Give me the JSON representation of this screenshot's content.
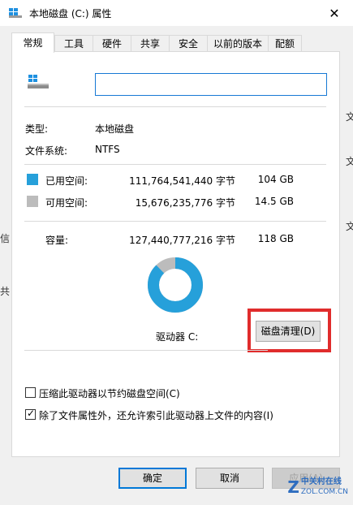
{
  "window": {
    "title": "本地磁盘 (C:) 属性",
    "close_glyph": "✕"
  },
  "tabs": [
    {
      "label": "常规",
      "active": true
    },
    {
      "label": "工具"
    },
    {
      "label": "硬件"
    },
    {
      "label": "共享"
    },
    {
      "label": "安全"
    },
    {
      "label": "以前的版本"
    },
    {
      "label": "配额"
    }
  ],
  "general": {
    "name_value": "",
    "type_label": "类型:",
    "type_value": "本地磁盘",
    "fs_label": "文件系统:",
    "fs_value": "NTFS",
    "used_label": "已用空间:",
    "used_bytes": "111,764,541,440 字节",
    "used_gb": "104 GB",
    "used_color": "#26a0da",
    "free_label": "可用空间:",
    "free_bytes": "15,676,235,776 字节",
    "free_gb": "14.5 GB",
    "free_color": "#bcbcbc",
    "capacity_label": "容量:",
    "capacity_bytes": "127,440,777,216 字节",
    "capacity_gb": "118 GB",
    "used_fraction": 0.877,
    "drive_label": "驱动器 C:",
    "cleanup_button": "磁盘清理(D)",
    "compress_label": "压缩此驱动器以节约磁盘空间(C)",
    "compress_checked": false,
    "index_label": "除了文件属性外，还允许索引此驱动器上文件的内容(I)",
    "index_checked": true,
    "highlight_color": "#e02c2c"
  },
  "buttons": {
    "ok": "确定",
    "cancel": "取消",
    "apply": "应用(A)"
  },
  "background_fragments": {
    "left_1": "信",
    "left_2": "共",
    "right_1": "文",
    "right_2": "文",
    "right_3": "文"
  },
  "watermark": {
    "mark": "Z",
    "cn": "中关村在线",
    "en": "ZOL.COM.CN"
  }
}
